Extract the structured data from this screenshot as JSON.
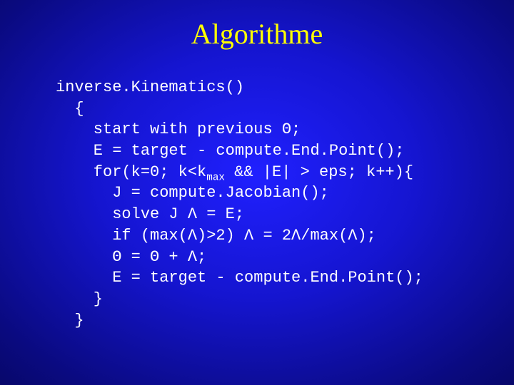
{
  "title": "Algorithme",
  "code": {
    "l1": "inverse.Kinematics()",
    "l2": "  {",
    "l3": "    start with previous Θ;",
    "l4": "    E = target - compute.End.Point();",
    "l5a": "    for(k=0; k<k",
    "l5_sub": "max",
    "l5b": " && |E| > eps; k++){",
    "l6": "      J = compute.Jacobian();",
    "l7": "      solve J Λ = E;",
    "l8": "      if (max(Λ)>2) Λ = 2Λ/max(Λ);",
    "l9": "      Θ = Θ + Λ;",
    "l10": "      E = target - compute.End.Point();",
    "l11": "    }",
    "l12": "  }"
  }
}
